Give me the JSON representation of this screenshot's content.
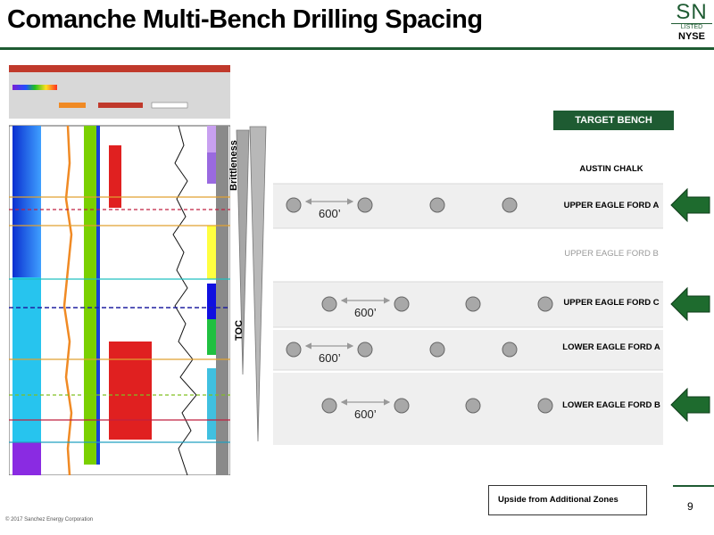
{
  "title": "Comanche Multi-Bench Drilling Spacing",
  "logo": {
    "main": "SN",
    "sub": "LISTED",
    "exchange": "NYSE"
  },
  "target_bench_label": "TARGET BENCH",
  "brittleness_label": "Brittleness",
  "toc_label": "TOC",
  "zones": [
    {
      "name": "AUSTIN CHALK",
      "target": false,
      "dim": false
    },
    {
      "name": "UPPER EAGLE FORD A",
      "target": true,
      "dim": false
    },
    {
      "name": "UPPER EAGLE FORD B",
      "target": false,
      "dim": true
    },
    {
      "name": "UPPER EAGLE FORD C",
      "target": true,
      "dim": false
    },
    {
      "name": "LOWER EAGLE FORD A",
      "target": false,
      "dim": false
    },
    {
      "name": "LOWER EAGLE FORD B",
      "target": true,
      "dim": false
    }
  ],
  "spacing_label": "600’",
  "legend_label": "Upside from Additional Zones",
  "page_number": "9",
  "copyright": "© 2017 Sanchez Energy Corporation",
  "colors": {
    "brand_green": "#1e5b32",
    "band_fill": "#efefef",
    "well_dot": "#a8a8a8"
  }
}
